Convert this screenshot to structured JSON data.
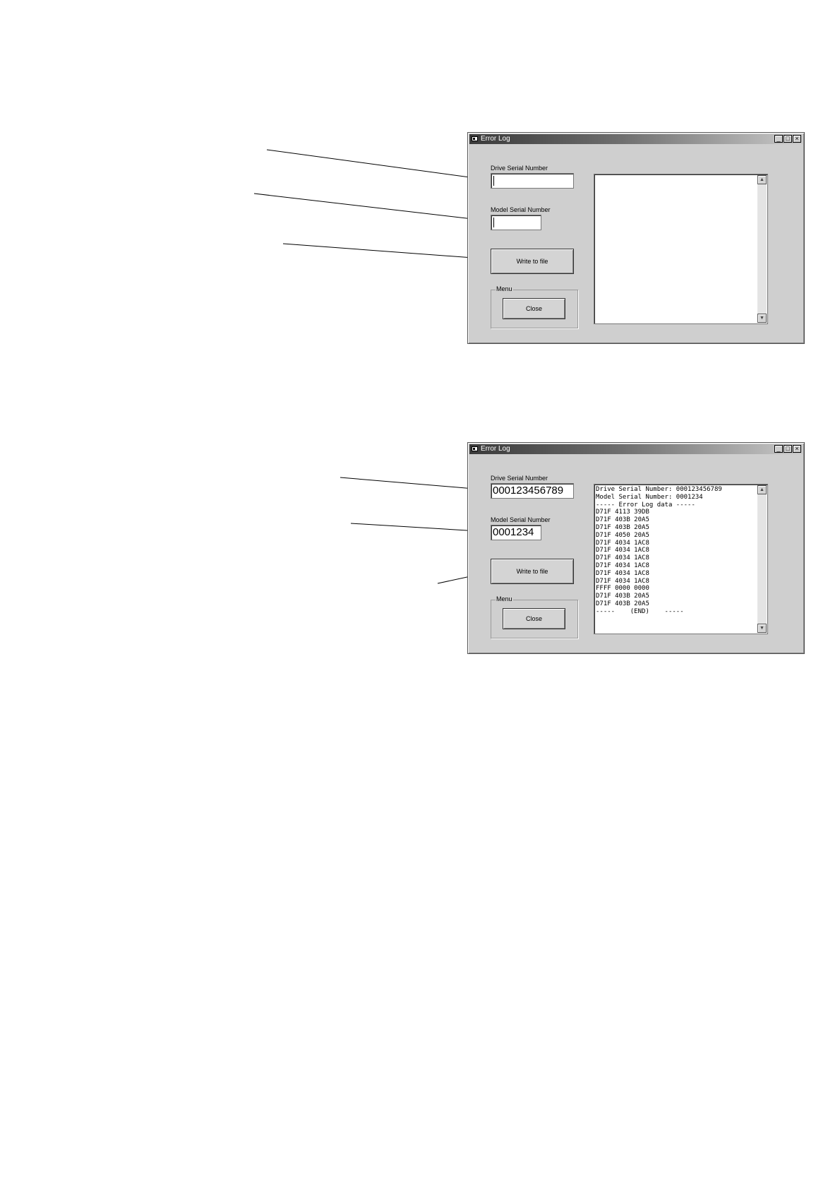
{
  "windows": [
    {
      "title": "Error Log",
      "drive_serial": {
        "label": "Drive Serial Number",
        "value": ""
      },
      "model_serial": {
        "label": "Model Serial Number",
        "value": ""
      },
      "write_button": "Write to file",
      "menu_group": {
        "label": "Menu",
        "close_button": "Close"
      },
      "log_text": "",
      "title_buttons": {
        "minimize": "_",
        "maximize": "□",
        "close": "×"
      },
      "scroll": {
        "up": "▲",
        "down": "▼"
      }
    },
    {
      "title": "Error Log",
      "drive_serial": {
        "label": "Drive Serial Number",
        "value": "000123456789"
      },
      "model_serial": {
        "label": "Model Serial Number",
        "value": "0001234"
      },
      "write_button": "Write to file",
      "menu_group": {
        "label": "Menu",
        "close_button": "Close"
      },
      "log_text": "Drive Serial Number: 000123456789\nModel Serial Number: 0001234\n----- Error Log data -----\nD71F 4113 39DB\nD71F 403B 20A5\nD71F 403B 20A5\nD71F 4050 20A5\nD71F 4034 1AC8\nD71F 4034 1AC8\nD71F 4034 1AC8\nD71F 4034 1AC8\nD71F 4034 1AC8\nD71F 4034 1AC8\nFFFF 0000 0000\nD71F 403B 20A5\nD71F 403B 20A5\n-----    (END)    -----",
      "title_buttons": {
        "minimize": "_",
        "maximize": "□",
        "close": "×"
      },
      "scroll": {
        "up": "▲",
        "down": "▼"
      }
    }
  ]
}
